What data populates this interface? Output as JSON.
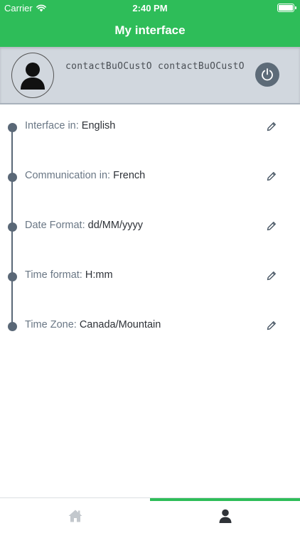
{
  "status_bar": {
    "carrier": "Carrier",
    "time": "2:40 PM",
    "icons": [
      "wifi-icon",
      "battery-icon"
    ]
  },
  "header": {
    "title": "My interface"
  },
  "profile": {
    "name": "contactBuOCustO contactBuOCustO",
    "icons": [
      "user-avatar-icon",
      "power-icon"
    ]
  },
  "settings": [
    {
      "label": "Interface in:",
      "value": "English"
    },
    {
      "label": "Communication in:",
      "value": "French"
    },
    {
      "label": "Date Format:",
      "value": "dd/MM/yyyy"
    },
    {
      "label": "Time format:",
      "value": "H:mm"
    },
    {
      "label": "Time Zone:",
      "value": "Canada/Mountain"
    }
  ],
  "tabs": [
    {
      "name": "home",
      "icon": "home-icon",
      "active": false
    },
    {
      "name": "profile",
      "icon": "user-icon",
      "active": true
    }
  ],
  "colors": {
    "brand_green": "#2ebd59",
    "profile_bg": "#d1d7de",
    "timeline": "#5a6877",
    "label_text": "#6a7785",
    "value_text": "#2d3137"
  }
}
